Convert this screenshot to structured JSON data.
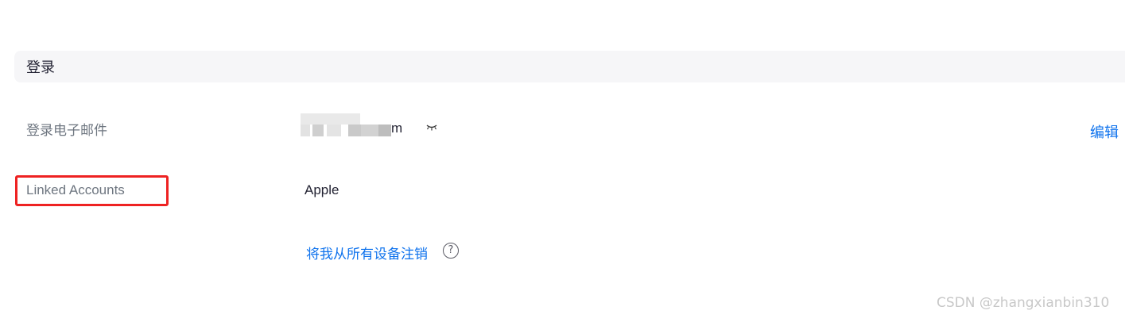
{
  "section": {
    "title": "登录"
  },
  "email_row": {
    "label": "登录电子邮件",
    "value_suffix": "m",
    "visibility_icon": "eye-closed-icon",
    "edit_label": "编辑"
  },
  "linked_row": {
    "label": "Linked Accounts",
    "value": "Apple"
  },
  "signout": {
    "label": "将我从所有设备注销",
    "help_icon": "question-circle-icon",
    "help_glyph": "?"
  },
  "watermark": "CSDN @zhangxianbin310",
  "colors": {
    "link": "#0e72ed",
    "highlight": "#ee2222",
    "header_bg": "#f6f6f8"
  }
}
